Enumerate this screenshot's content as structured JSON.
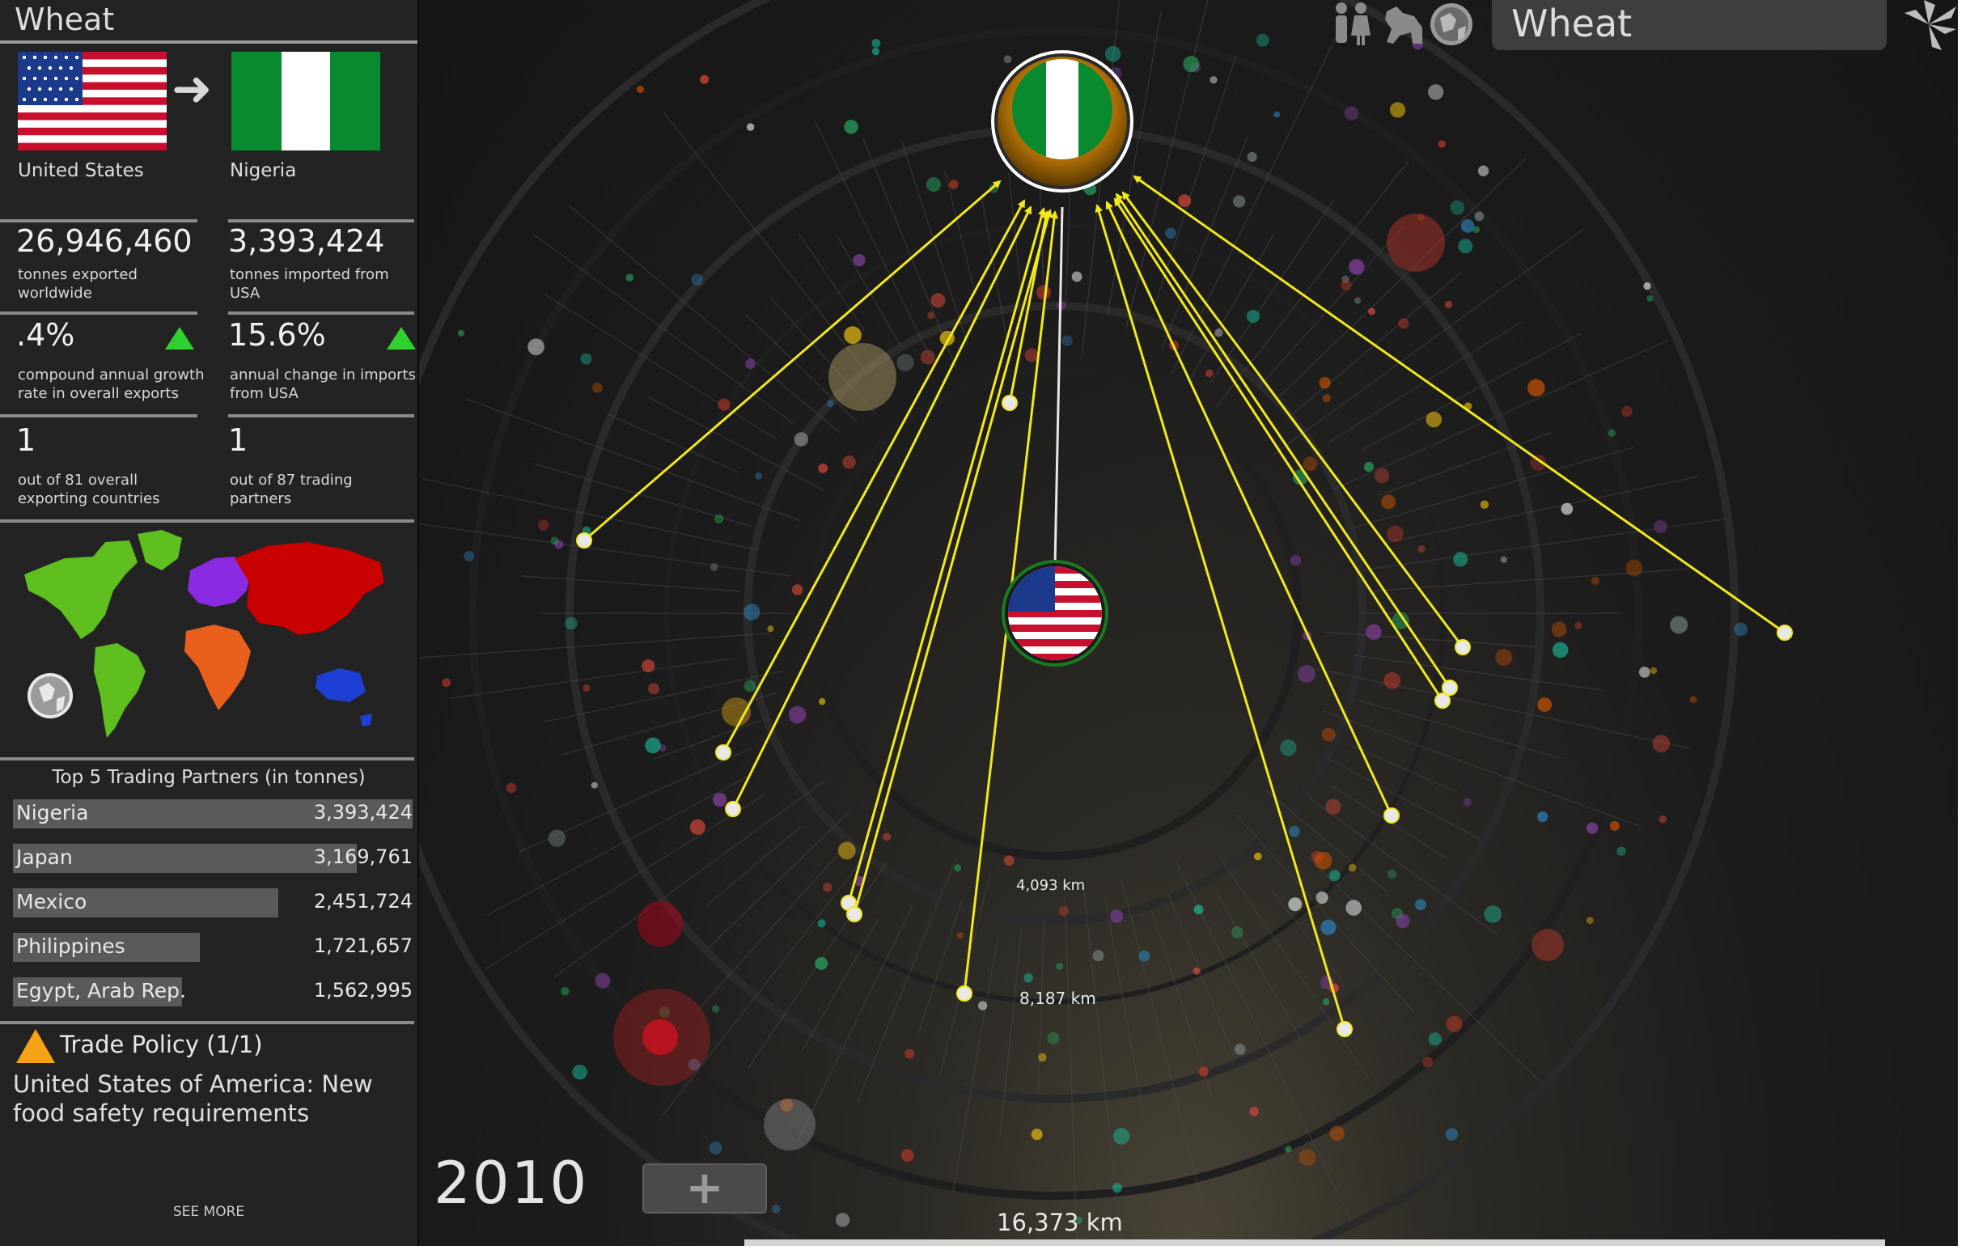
{
  "sidebar": {
    "title": "Wheat",
    "exporter": {
      "name": "United States"
    },
    "importer": {
      "name": "Nigeria"
    },
    "stats": {
      "exported_value": "26,946,460",
      "exported_caption_1": "tonnes exported",
      "exported_caption_2": "worldwide",
      "imported_value": "3,393,424",
      "imported_caption_1": "tonnes imported from",
      "imported_caption_2": "USA",
      "cagr_value": ".4%",
      "cagr_caption_1": "compound annual growth",
      "cagr_caption_2": "rate in overall exports",
      "annual_change_value": "15.6%",
      "annual_change_caption_1": "annual change in imports",
      "annual_change_caption_2": "from USA",
      "export_rank_value": "1",
      "export_rank_caption_1": "out of 81 overall",
      "export_rank_caption_2": "exporting countries",
      "partner_rank_value": "1",
      "partner_rank_caption": "out of 87 trading partners"
    },
    "partners": {
      "title": "Top 5 Trading Partners (in tonnes)",
      "rows": [
        {
          "name": "Nigeria",
          "value": "3,393,424",
          "amount": 3393424
        },
        {
          "name": "Japan",
          "value": "3,169,761",
          "amount": 3169761
        },
        {
          "name": "Mexico",
          "value": "2,451,724",
          "amount": 2451724
        },
        {
          "name": "Philippines",
          "value": "1,721,657",
          "amount": 1721657
        },
        {
          "name": "Egypt, Arab Rep.",
          "value": "1,562,995",
          "amount": 1562995
        }
      ]
    },
    "policy": {
      "title": "Trade Policy (1/1)",
      "text": "United States of America: New food safety requirements"
    },
    "see_more": "SEE MORE"
  },
  "toolbar": {
    "search_value": "Wheat",
    "icons": [
      "people-icon",
      "animal-icon",
      "globe-icon",
      "loading-spinner-icon"
    ]
  },
  "viz": {
    "year": "2010",
    "distances": [
      "4,093 km",
      "8,187 km",
      "16,373 km"
    ]
  },
  "colors": {
    "trade_line": "#f2e81e",
    "up_indicator": "#2fd12f",
    "warning": "#f5a315",
    "region_north_america": "#5fbf1e",
    "region_south_america": "#5fbf1e",
    "region_europe": "#8a2be2",
    "region_asia": "#c80000",
    "region_africa": "#e8601c",
    "region_oceania": "#1e3fd4"
  }
}
